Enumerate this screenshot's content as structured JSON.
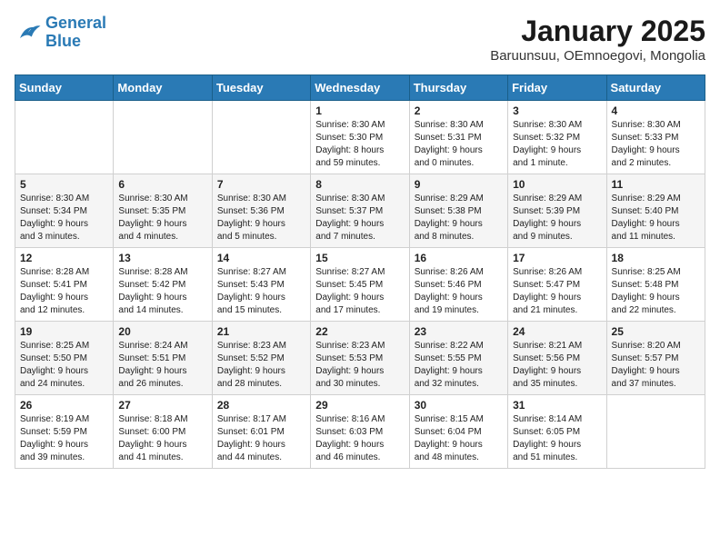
{
  "logo": {
    "line1": "General",
    "line2": "Blue"
  },
  "title": "January 2025",
  "subtitle": "Baruunsuu, OEmnoegovi, Mongolia",
  "days_of_week": [
    "Sunday",
    "Monday",
    "Tuesday",
    "Wednesday",
    "Thursday",
    "Friday",
    "Saturday"
  ],
  "weeks": [
    [
      {
        "day": "",
        "info": ""
      },
      {
        "day": "",
        "info": ""
      },
      {
        "day": "",
        "info": ""
      },
      {
        "day": "1",
        "info": "Sunrise: 8:30 AM\nSunset: 5:30 PM\nDaylight: 8 hours\nand 59 minutes."
      },
      {
        "day": "2",
        "info": "Sunrise: 8:30 AM\nSunset: 5:31 PM\nDaylight: 9 hours\nand 0 minutes."
      },
      {
        "day": "3",
        "info": "Sunrise: 8:30 AM\nSunset: 5:32 PM\nDaylight: 9 hours\nand 1 minute."
      },
      {
        "day": "4",
        "info": "Sunrise: 8:30 AM\nSunset: 5:33 PM\nDaylight: 9 hours\nand 2 minutes."
      }
    ],
    [
      {
        "day": "5",
        "info": "Sunrise: 8:30 AM\nSunset: 5:34 PM\nDaylight: 9 hours\nand 3 minutes."
      },
      {
        "day": "6",
        "info": "Sunrise: 8:30 AM\nSunset: 5:35 PM\nDaylight: 9 hours\nand 4 minutes."
      },
      {
        "day": "7",
        "info": "Sunrise: 8:30 AM\nSunset: 5:36 PM\nDaylight: 9 hours\nand 5 minutes."
      },
      {
        "day": "8",
        "info": "Sunrise: 8:30 AM\nSunset: 5:37 PM\nDaylight: 9 hours\nand 7 minutes."
      },
      {
        "day": "9",
        "info": "Sunrise: 8:29 AM\nSunset: 5:38 PM\nDaylight: 9 hours\nand 8 minutes."
      },
      {
        "day": "10",
        "info": "Sunrise: 8:29 AM\nSunset: 5:39 PM\nDaylight: 9 hours\nand 9 minutes."
      },
      {
        "day": "11",
        "info": "Sunrise: 8:29 AM\nSunset: 5:40 PM\nDaylight: 9 hours\nand 11 minutes."
      }
    ],
    [
      {
        "day": "12",
        "info": "Sunrise: 8:28 AM\nSunset: 5:41 PM\nDaylight: 9 hours\nand 12 minutes."
      },
      {
        "day": "13",
        "info": "Sunrise: 8:28 AM\nSunset: 5:42 PM\nDaylight: 9 hours\nand 14 minutes."
      },
      {
        "day": "14",
        "info": "Sunrise: 8:27 AM\nSunset: 5:43 PM\nDaylight: 9 hours\nand 15 minutes."
      },
      {
        "day": "15",
        "info": "Sunrise: 8:27 AM\nSunset: 5:45 PM\nDaylight: 9 hours\nand 17 minutes."
      },
      {
        "day": "16",
        "info": "Sunrise: 8:26 AM\nSunset: 5:46 PM\nDaylight: 9 hours\nand 19 minutes."
      },
      {
        "day": "17",
        "info": "Sunrise: 8:26 AM\nSunset: 5:47 PM\nDaylight: 9 hours\nand 21 minutes."
      },
      {
        "day": "18",
        "info": "Sunrise: 8:25 AM\nSunset: 5:48 PM\nDaylight: 9 hours\nand 22 minutes."
      }
    ],
    [
      {
        "day": "19",
        "info": "Sunrise: 8:25 AM\nSunset: 5:50 PM\nDaylight: 9 hours\nand 24 minutes."
      },
      {
        "day": "20",
        "info": "Sunrise: 8:24 AM\nSunset: 5:51 PM\nDaylight: 9 hours\nand 26 minutes."
      },
      {
        "day": "21",
        "info": "Sunrise: 8:23 AM\nSunset: 5:52 PM\nDaylight: 9 hours\nand 28 minutes."
      },
      {
        "day": "22",
        "info": "Sunrise: 8:23 AM\nSunset: 5:53 PM\nDaylight: 9 hours\nand 30 minutes."
      },
      {
        "day": "23",
        "info": "Sunrise: 8:22 AM\nSunset: 5:55 PM\nDaylight: 9 hours\nand 32 minutes."
      },
      {
        "day": "24",
        "info": "Sunrise: 8:21 AM\nSunset: 5:56 PM\nDaylight: 9 hours\nand 35 minutes."
      },
      {
        "day": "25",
        "info": "Sunrise: 8:20 AM\nSunset: 5:57 PM\nDaylight: 9 hours\nand 37 minutes."
      }
    ],
    [
      {
        "day": "26",
        "info": "Sunrise: 8:19 AM\nSunset: 5:59 PM\nDaylight: 9 hours\nand 39 minutes."
      },
      {
        "day": "27",
        "info": "Sunrise: 8:18 AM\nSunset: 6:00 PM\nDaylight: 9 hours\nand 41 minutes."
      },
      {
        "day": "28",
        "info": "Sunrise: 8:17 AM\nSunset: 6:01 PM\nDaylight: 9 hours\nand 44 minutes."
      },
      {
        "day": "29",
        "info": "Sunrise: 8:16 AM\nSunset: 6:03 PM\nDaylight: 9 hours\nand 46 minutes."
      },
      {
        "day": "30",
        "info": "Sunrise: 8:15 AM\nSunset: 6:04 PM\nDaylight: 9 hours\nand 48 minutes."
      },
      {
        "day": "31",
        "info": "Sunrise: 8:14 AM\nSunset: 6:05 PM\nDaylight: 9 hours\nand 51 minutes."
      },
      {
        "day": "",
        "info": ""
      }
    ]
  ]
}
